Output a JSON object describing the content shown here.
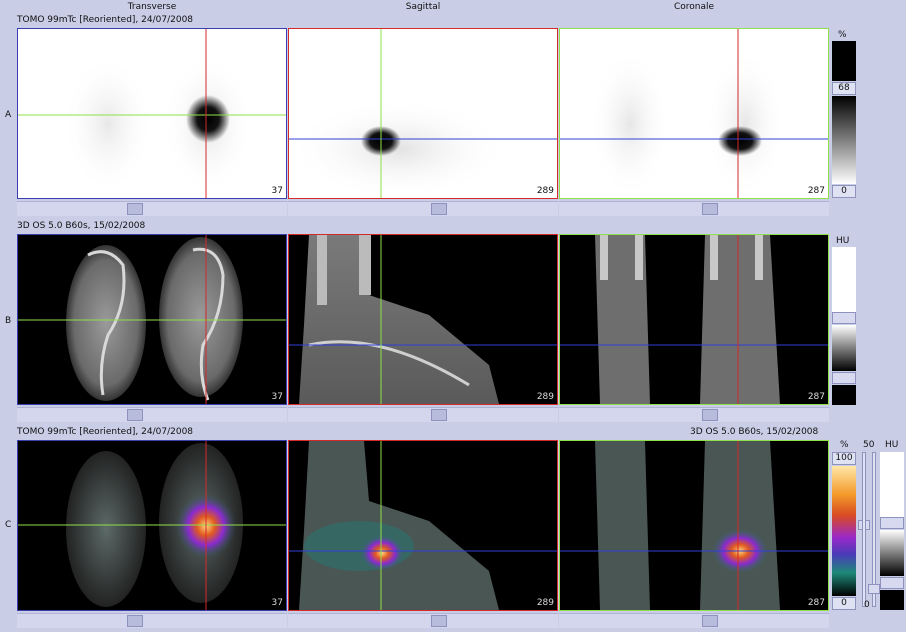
{
  "columns": {
    "transverse": "Transverse",
    "sagittal": "Sagittal",
    "coronal": "Coronale"
  },
  "rows": {
    "a": {
      "letter": "A",
      "series": "TOMO 99mTc [Reoriented], 24/07/2008"
    },
    "b": {
      "letter": "B",
      "series": "3D  OS  5.0  B60s, 15/02/2008"
    },
    "c": {
      "letter": "C",
      "series_left": "TOMO 99mTc [Reoriented], 24/07/2008",
      "series_right": "3D  OS  5.0  B60s, 15/02/2008"
    }
  },
  "slices": {
    "transverse": "37",
    "sagittal": "289",
    "coronal": "287"
  },
  "scale_a": {
    "unit": "%",
    "max": "68",
    "min": "0"
  },
  "scale_b": {
    "unit": "HU"
  },
  "scale_c": {
    "unit_pct": "%",
    "max_pct": "100",
    "min_pct": "0",
    "unit_hu": "HU",
    "hu_top": "50",
    "hu_bottom": "0"
  },
  "colors": {
    "crosshair_red": "#d42a2a",
    "crosshair_green": "#8fe04a",
    "crosshair_blue": "#3040d8"
  }
}
